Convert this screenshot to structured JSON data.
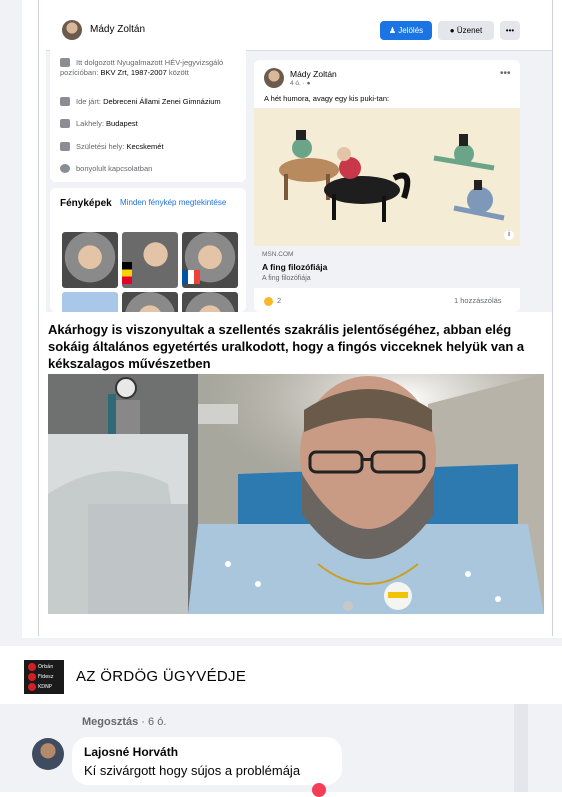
{
  "screenshot": {
    "topbar": {
      "profile_name": "Mády Zoltán",
      "follow_label": "Jelölés",
      "message_label": "Üzenet",
      "more_label": "•••"
    },
    "intro": {
      "work_prefix": "Itt dolgozott Nyugalmazott HÉV-jegyvizsgáló pozícióban: ",
      "work_place": "BKV Zrt, 1987-2007",
      "work_suffix": "között",
      "school_prefix": "Ide járt: ",
      "school_name": "Debreceni Állami Zenei Gimnázium",
      "lives_prefix": "Lakhely: ",
      "lives_city": "Budapest",
      "birth_prefix": "Születési hely: ",
      "birth_city": "Kecskemét",
      "relationship": "bonyolult kapcsolatban"
    },
    "photos": {
      "title": "Fényképek",
      "see_all": "Minden fénykép megtekintése"
    },
    "post": {
      "author": "Mády Zoltán",
      "time": "4 ó. · ",
      "text": "A hét humora, avagy egy kis puki-tan:",
      "link_source": "MSN.COM",
      "link_title": "A fing filozófiája",
      "link_subtitle": "A fing filozófiája",
      "reaction_count": "2",
      "comment_count": "1 hozzászólás",
      "more_label": "•••"
    }
  },
  "headline": "Akárhogy is viszonyultak a szellentés szakrális jelentőségéhez, abban elég sokáig általános egyetértés uralkodott, hogy a fingós vicceknek helyük van a kékszalagos művészetben",
  "page": {
    "name": "AZ ÖRDÖG ÜGYVÉDJE",
    "logo_lines": [
      "Orbán",
      "Fidesz",
      "KDNP"
    ]
  },
  "share": {
    "label": "Megosztás",
    "time": " · 6 ó."
  },
  "comment": {
    "author": "Lajosné Horváth",
    "text": "Kí szivárgott hogy sújos a problémája"
  }
}
